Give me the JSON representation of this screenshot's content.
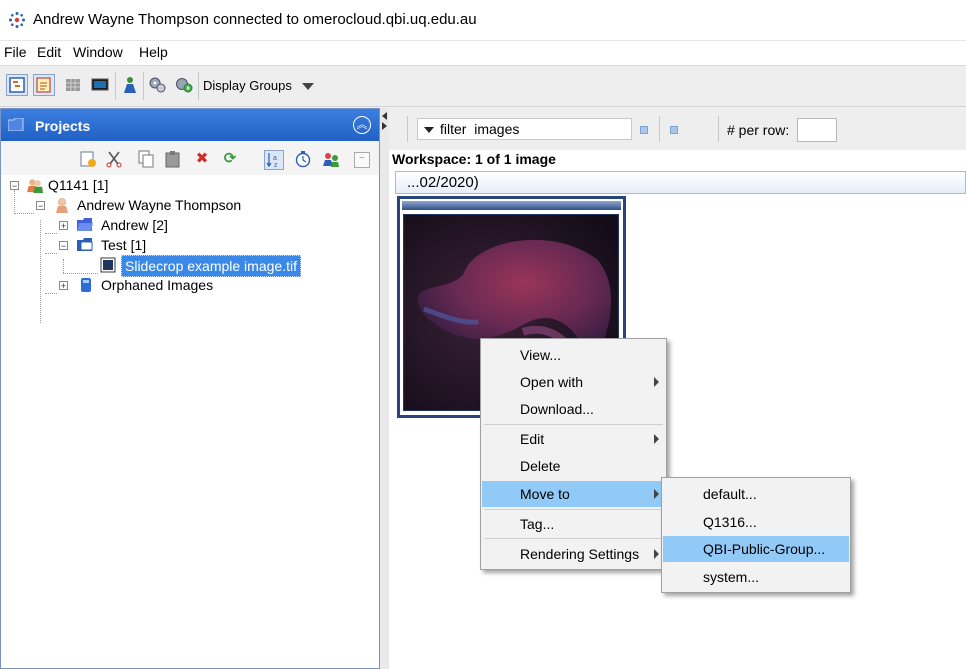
{
  "window": {
    "title": "Andrew Wayne Thompson connected to omerocloud.qbi.uq.edu.au"
  },
  "menubar": {
    "items": [
      "File",
      "Edit",
      "Window",
      "Help"
    ]
  },
  "toolbar": {
    "display_groups_label": "Display Groups"
  },
  "projects_panel": {
    "title": "Projects",
    "tree": {
      "group": "Q1141 [1]",
      "user": "Andrew Wayne Thompson",
      "datasets": [
        {
          "label": "Andrew [2]"
        },
        {
          "label": "Test [1]",
          "children": [
            {
              "label": "Slidecrop example image.tif",
              "selected": true
            }
          ]
        }
      ],
      "orphaned": "Orphaned Images"
    }
  },
  "filter_bar": {
    "filter_value": "filter  images",
    "per_row_label": "# per row:",
    "per_row_value": ""
  },
  "workspace": {
    "status": "Workspace: 1 of 1 image",
    "date_header": "...02/2020)"
  },
  "context_menu": {
    "items": [
      {
        "label": "View..."
      },
      {
        "label": "Open with"
      },
      {
        "label": "Download..."
      },
      {
        "label": "Edit"
      },
      {
        "label": "Delete"
      },
      {
        "label": "Move to",
        "highlighted": true
      },
      {
        "label": "Tag..."
      },
      {
        "label": "Rendering Settings"
      }
    ],
    "submenu": {
      "items": [
        {
          "label": "default..."
        },
        {
          "label": "Q1316..."
        },
        {
          "label": "QBI-Public-Group...",
          "highlighted": true
        },
        {
          "label": "system..."
        }
      ]
    }
  },
  "colors": {
    "selection": "#3a89e6",
    "menu_highlight": "#91c9f7",
    "panel_header": "#2a6bd0",
    "thumbnail_frame": "#27457a"
  }
}
